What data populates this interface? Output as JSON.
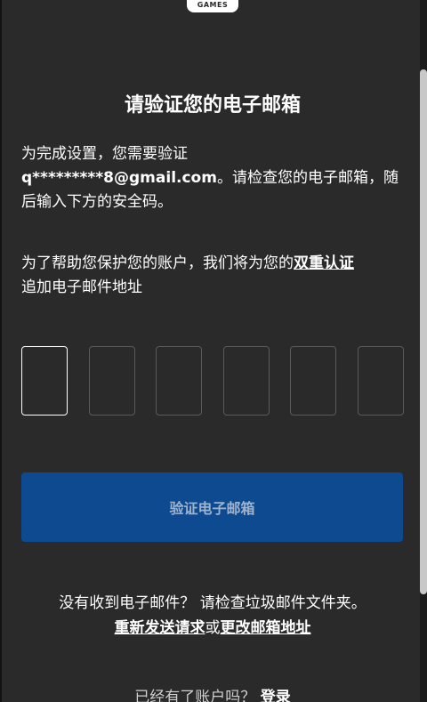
{
  "logo": {
    "text": "GAMES"
  },
  "title": "请验证您的电子邮箱",
  "intro": {
    "prefix": "为完成设置，您需要验证",
    "email": "q*********8@gmail.com",
    "suffix": "。请检查您的电子邮箱，随后输入下方的安全码。"
  },
  "twofa": {
    "prefix": "为了帮助您保护您的账户，我们将为您的",
    "link": "双重认证",
    "suffix": "追加电子邮件地址"
  },
  "code_boxes": [
    {
      "value": "",
      "active": true
    },
    {
      "value": "",
      "active": false
    },
    {
      "value": "",
      "active": false
    },
    {
      "value": "",
      "active": false
    },
    {
      "value": "",
      "active": false
    },
    {
      "value": "",
      "active": false
    }
  ],
  "verify_button": {
    "label": "验证电子邮箱",
    "color": "#0d4a8f"
  },
  "footer": {
    "no_email_text": "没有收到电子邮件？ 请检查垃圾邮件文件夹。",
    "resend_link": "重新发送请求",
    "or_text": "或",
    "change_link": "更改邮箱地址",
    "have_account_text": "已经有了账户吗？",
    "login_link": "登录"
  },
  "colors": {
    "background": "#2a2a2a",
    "accent": "#0d4a8f"
  }
}
